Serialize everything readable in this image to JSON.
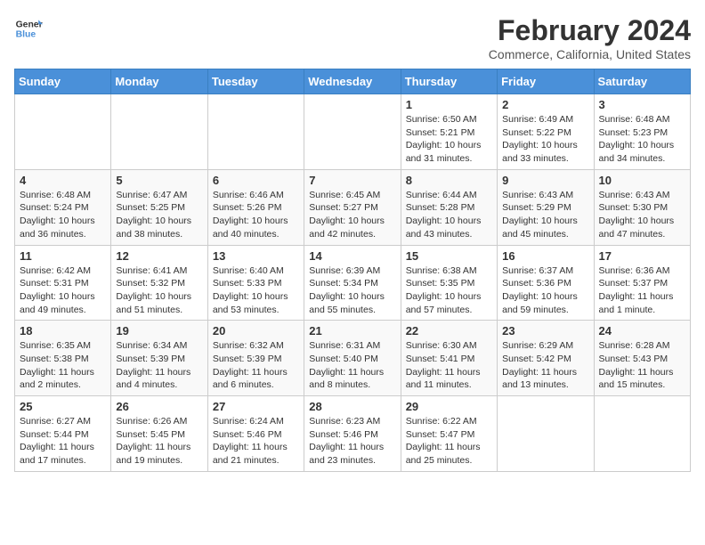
{
  "logo": {
    "line1": "General",
    "line2": "Blue"
  },
  "title": "February 2024",
  "subtitle": "Commerce, California, United States",
  "days_header": [
    "Sunday",
    "Monday",
    "Tuesday",
    "Wednesday",
    "Thursday",
    "Friday",
    "Saturday"
  ],
  "weeks": [
    [
      {
        "day": "",
        "info": ""
      },
      {
        "day": "",
        "info": ""
      },
      {
        "day": "",
        "info": ""
      },
      {
        "day": "",
        "info": ""
      },
      {
        "day": "1",
        "info": "Sunrise: 6:50 AM\nSunset: 5:21 PM\nDaylight: 10 hours\nand 31 minutes."
      },
      {
        "day": "2",
        "info": "Sunrise: 6:49 AM\nSunset: 5:22 PM\nDaylight: 10 hours\nand 33 minutes."
      },
      {
        "day": "3",
        "info": "Sunrise: 6:48 AM\nSunset: 5:23 PM\nDaylight: 10 hours\nand 34 minutes."
      }
    ],
    [
      {
        "day": "4",
        "info": "Sunrise: 6:48 AM\nSunset: 5:24 PM\nDaylight: 10 hours\nand 36 minutes."
      },
      {
        "day": "5",
        "info": "Sunrise: 6:47 AM\nSunset: 5:25 PM\nDaylight: 10 hours\nand 38 minutes."
      },
      {
        "day": "6",
        "info": "Sunrise: 6:46 AM\nSunset: 5:26 PM\nDaylight: 10 hours\nand 40 minutes."
      },
      {
        "day": "7",
        "info": "Sunrise: 6:45 AM\nSunset: 5:27 PM\nDaylight: 10 hours\nand 42 minutes."
      },
      {
        "day": "8",
        "info": "Sunrise: 6:44 AM\nSunset: 5:28 PM\nDaylight: 10 hours\nand 43 minutes."
      },
      {
        "day": "9",
        "info": "Sunrise: 6:43 AM\nSunset: 5:29 PM\nDaylight: 10 hours\nand 45 minutes."
      },
      {
        "day": "10",
        "info": "Sunrise: 6:43 AM\nSunset: 5:30 PM\nDaylight: 10 hours\nand 47 minutes."
      }
    ],
    [
      {
        "day": "11",
        "info": "Sunrise: 6:42 AM\nSunset: 5:31 PM\nDaylight: 10 hours\nand 49 minutes."
      },
      {
        "day": "12",
        "info": "Sunrise: 6:41 AM\nSunset: 5:32 PM\nDaylight: 10 hours\nand 51 minutes."
      },
      {
        "day": "13",
        "info": "Sunrise: 6:40 AM\nSunset: 5:33 PM\nDaylight: 10 hours\nand 53 minutes."
      },
      {
        "day": "14",
        "info": "Sunrise: 6:39 AM\nSunset: 5:34 PM\nDaylight: 10 hours\nand 55 minutes."
      },
      {
        "day": "15",
        "info": "Sunrise: 6:38 AM\nSunset: 5:35 PM\nDaylight: 10 hours\nand 57 minutes."
      },
      {
        "day": "16",
        "info": "Sunrise: 6:37 AM\nSunset: 5:36 PM\nDaylight: 10 hours\nand 59 minutes."
      },
      {
        "day": "17",
        "info": "Sunrise: 6:36 AM\nSunset: 5:37 PM\nDaylight: 11 hours\nand 1 minute."
      }
    ],
    [
      {
        "day": "18",
        "info": "Sunrise: 6:35 AM\nSunset: 5:38 PM\nDaylight: 11 hours\nand 2 minutes."
      },
      {
        "day": "19",
        "info": "Sunrise: 6:34 AM\nSunset: 5:39 PM\nDaylight: 11 hours\nand 4 minutes."
      },
      {
        "day": "20",
        "info": "Sunrise: 6:32 AM\nSunset: 5:39 PM\nDaylight: 11 hours\nand 6 minutes."
      },
      {
        "day": "21",
        "info": "Sunrise: 6:31 AM\nSunset: 5:40 PM\nDaylight: 11 hours\nand 8 minutes."
      },
      {
        "day": "22",
        "info": "Sunrise: 6:30 AM\nSunset: 5:41 PM\nDaylight: 11 hours\nand 11 minutes."
      },
      {
        "day": "23",
        "info": "Sunrise: 6:29 AM\nSunset: 5:42 PM\nDaylight: 11 hours\nand 13 minutes."
      },
      {
        "day": "24",
        "info": "Sunrise: 6:28 AM\nSunset: 5:43 PM\nDaylight: 11 hours\nand 15 minutes."
      }
    ],
    [
      {
        "day": "25",
        "info": "Sunrise: 6:27 AM\nSunset: 5:44 PM\nDaylight: 11 hours\nand 17 minutes."
      },
      {
        "day": "26",
        "info": "Sunrise: 6:26 AM\nSunset: 5:45 PM\nDaylight: 11 hours\nand 19 minutes."
      },
      {
        "day": "27",
        "info": "Sunrise: 6:24 AM\nSunset: 5:46 PM\nDaylight: 11 hours\nand 21 minutes."
      },
      {
        "day": "28",
        "info": "Sunrise: 6:23 AM\nSunset: 5:46 PM\nDaylight: 11 hours\nand 23 minutes."
      },
      {
        "day": "29",
        "info": "Sunrise: 6:22 AM\nSunset: 5:47 PM\nDaylight: 11 hours\nand 25 minutes."
      },
      {
        "day": "",
        "info": ""
      },
      {
        "day": "",
        "info": ""
      }
    ]
  ]
}
